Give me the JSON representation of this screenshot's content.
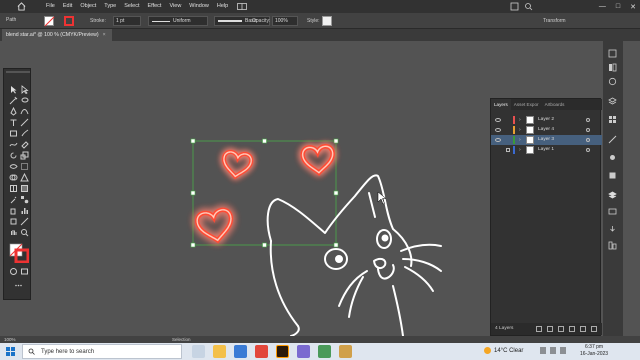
{
  "menubar": {
    "items": [
      "File",
      "Edit",
      "Object",
      "Type",
      "Select",
      "Effect",
      "View",
      "Window",
      "Help"
    ],
    "window_controls": [
      "—",
      "□",
      "✕"
    ]
  },
  "controlbar": {
    "path_label": "Path",
    "stroke_label": "Stroke:",
    "stroke_weight": "1 pt",
    "profile": "Uniform",
    "brush": "Basic",
    "opacity_label": "Opacity:",
    "opacity_value": "100%",
    "style_label": "Style:",
    "transform_label": "Transform",
    "stroke_color": "#e8382f"
  },
  "document": {
    "tab_title": "blend star.ai* @ 100 % (CMYK/Preview)",
    "close": "×"
  },
  "canvas": {
    "heart_color": "#ff6a50",
    "glow_color": "#ff2a10",
    "selection_color": "#4aaa4a",
    "cat_stroke": "#ffffff"
  },
  "layers_panel": {
    "tabs": [
      "Layers",
      "Asset Expor",
      "Artboards"
    ],
    "active_tab": "Layers",
    "layers": [
      {
        "name": "Layer 2",
        "color": "#e85050",
        "selected": false,
        "locked": false,
        "visible": true
      },
      {
        "name": "Layer 4",
        "color": "#e8a030",
        "selected": false,
        "locked": false,
        "visible": true
      },
      {
        "name": "Layer 3",
        "color": "#3a9a3a",
        "selected": true,
        "locked": false,
        "visible": true
      },
      {
        "name": "Layer 1",
        "color": "#3a6ad0",
        "selected": false,
        "locked": true,
        "visible": false
      }
    ],
    "count": "4 Layers"
  },
  "statusbar": {
    "zoom": "100%",
    "tool": "Selection"
  },
  "taskbar": {
    "search_placeholder": "Type here to search",
    "weather": "14°C  Clear",
    "time": "6:37 pm",
    "date": "16-Jan-2023"
  }
}
